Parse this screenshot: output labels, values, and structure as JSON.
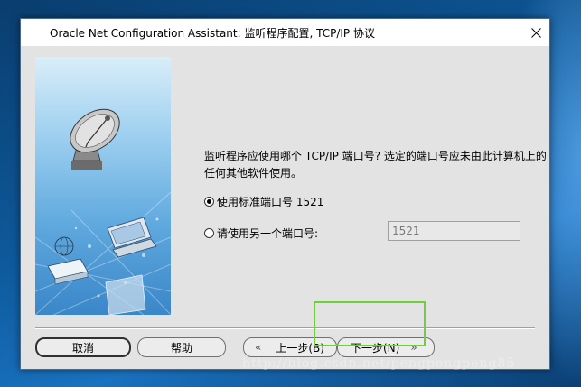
{
  "window": {
    "title": "Oracle Net Configuration Assistant: 监听程序配置, TCP/IP 协议"
  },
  "content": {
    "question": "监听程序应使用哪个 TCP/IP 端口号? 选定的端口号应未由此计算机上的任何其他软件使用。",
    "option_standard": "使用标准端口号 1521",
    "option_other": "请使用另一个端口号:",
    "port_value": "1521",
    "selected_option": "standard"
  },
  "buttons": {
    "cancel": "取消",
    "help": "帮助",
    "back": "上一步(B)",
    "next": "下一步(N)"
  },
  "icons": {
    "back_chevron": "«",
    "next_chevron": "»"
  },
  "watermark": "http://blog.csdn.net/pengpengpeng85",
  "colors": {
    "highlight": "#6ed13a"
  }
}
